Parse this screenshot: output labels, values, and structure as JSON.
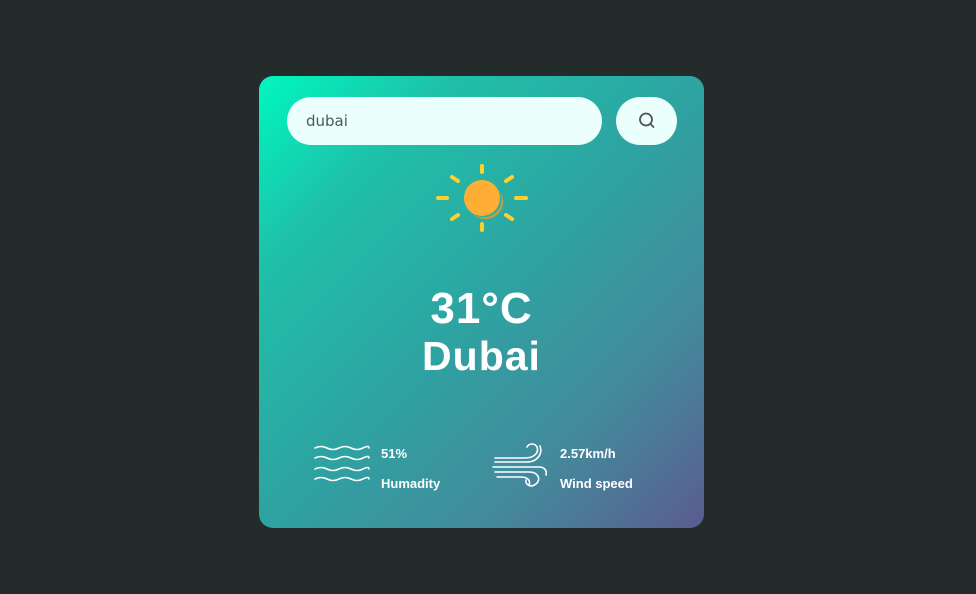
{
  "search": {
    "value": "dubai",
    "placeholder": ""
  },
  "search_button": {
    "icon": "search-icon"
  },
  "weather": {
    "icon": "sun-icon",
    "temperature": "31°C",
    "city": "Dubai"
  },
  "details": {
    "humidity": {
      "icon": "humidity-waves-icon",
      "value": "51%",
      "label": "Humadity"
    },
    "wind": {
      "icon": "wind-icon",
      "value": "2.57km/h",
      "label": "Wind speed"
    }
  },
  "colors": {
    "background": "#232b2b",
    "card_gradient_start": "#00f7c0",
    "card_gradient_end": "#5b5c8f",
    "input_background": "#ebfffc",
    "sun_core": "#ffae35",
    "sun_rays": "#ffcf2a"
  }
}
